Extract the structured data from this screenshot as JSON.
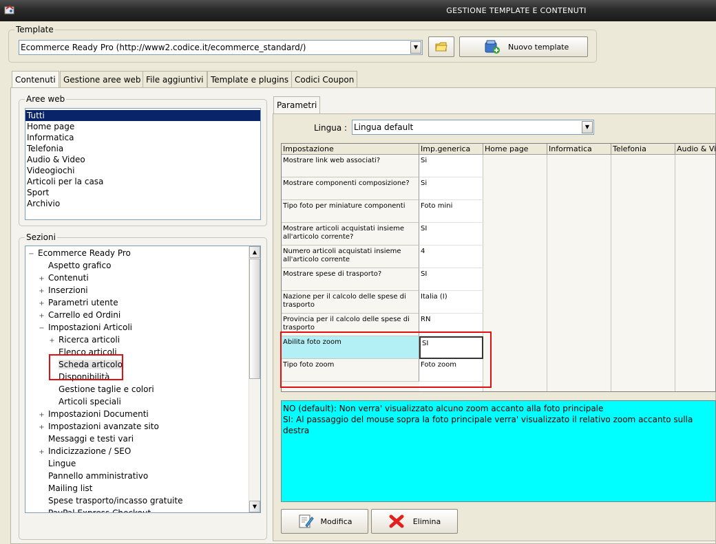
{
  "window": {
    "title": "GESTIONE TEMPLATE E CONTENUTI"
  },
  "template": {
    "group_label": "Template",
    "selected": "Ecommerce Ready Pro (http://www2.codice.it/ecommerce_standard/)",
    "new_button": "Nuovo template"
  },
  "tabs": [
    "Contenuti",
    "Gestione aree web",
    "File aggiuntivi",
    "Template e plugins",
    "Codici Coupon"
  ],
  "aree_web": {
    "label": "Aree web",
    "items": [
      "Tutti",
      "Home page",
      "Informatica",
      "Telefonia",
      "Audio & Video",
      "Videogiochi",
      "Articoli per la casa",
      "Sport",
      "Archivio"
    ],
    "selected": "Tutti"
  },
  "sezioni": {
    "label": "Sezioni",
    "tree": [
      {
        "label": "Ecommerce Ready Pro",
        "exp": "−"
      },
      {
        "label": "Aspetto grafico",
        "exp": ""
      },
      {
        "label": "Contenuti",
        "exp": "+"
      },
      {
        "label": "Inserzioni",
        "exp": "+"
      },
      {
        "label": "Parametri utente",
        "exp": "+"
      },
      {
        "label": "Carrello ed Ordini",
        "exp": "+"
      },
      {
        "label": "Impostazioni Articoli",
        "exp": "−"
      },
      {
        "label": "Ricerca articoli",
        "exp": "+"
      },
      {
        "label": "Elenco articoli",
        "exp": ""
      },
      {
        "label": "Scheda articolo",
        "exp": ""
      },
      {
        "label": "Disponibilità",
        "exp": ""
      },
      {
        "label": "Gestione taglie e colori",
        "exp": ""
      },
      {
        "label": "Articoli speciali",
        "exp": ""
      },
      {
        "label": "Impostazioni Documenti",
        "exp": "+"
      },
      {
        "label": "Impostazioni avanzate sito",
        "exp": "+"
      },
      {
        "label": "Messaggi e testi vari",
        "exp": ""
      },
      {
        "label": "Indicizzazione / SEO",
        "exp": "+"
      },
      {
        "label": "Lingue",
        "exp": ""
      },
      {
        "label": "Pannello amministrativo",
        "exp": ""
      },
      {
        "label": "Mailing list",
        "exp": ""
      },
      {
        "label": "Spese trasporto/incasso gratuite",
        "exp": ""
      },
      {
        "label": "PayPal Express Checkout",
        "exp": ""
      }
    ]
  },
  "parametri": {
    "tab_label": "Parametri",
    "lingua_label": "Lingua :",
    "lingua_value": "Lingua default",
    "columns": [
      "Impostazione",
      "Imp.generica",
      "Home page",
      "Informatica",
      "Telefonia",
      "Audio & Video"
    ],
    "rows": [
      {
        "setting": "Mostrare link web associati?",
        "value": "Si"
      },
      {
        "setting": "Mostrare componenti composizione?",
        "value": "Si"
      },
      {
        "setting": "Tipo foto per miniature componenti",
        "value": "Foto mini"
      },
      {
        "setting": "Mostrare articoli acquistati insieme all'articolo corrente?",
        "value": "SI"
      },
      {
        "setting": "Numero articoli acquistati insieme all'articolo corrente",
        "value": "4"
      },
      {
        "setting": "Mostrare spese di trasporto?",
        "value": "SI"
      },
      {
        "setting": "Nazione per il calcolo delle spese di trasporto",
        "value": "Italia (I)"
      },
      {
        "setting": "Provincia per il calcolo delle spese di trasporto",
        "value": "RN"
      },
      {
        "setting": "Abilita foto zoom",
        "value": "SI"
      },
      {
        "setting": "Tipo foto zoom",
        "value": "Foto zoom"
      }
    ],
    "selected_row": 8,
    "description_lines": [
      "NO (default): Non verra' visualizzato alcuno zoom accanto alla foto principale",
      "SI: Al passaggio del mouse sopra la foto principale verra' visualizzato il relativo zoom accanto sulla destra"
    ],
    "edit_button": "Modifica",
    "delete_button": "Elimina"
  },
  "colors": {
    "selection": "#0a246a",
    "grid_selection": "#b3f0f5",
    "description_bg": "#00ffff",
    "highlight_box": "#e01010"
  }
}
